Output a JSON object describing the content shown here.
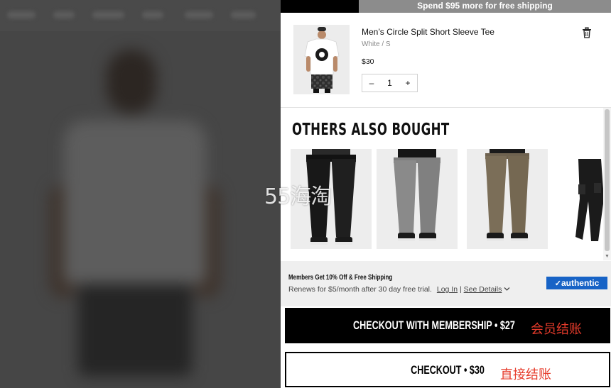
{
  "shipping_banner": {
    "text": "Spend $95 more for free shipping"
  },
  "cart_item": {
    "name": "Men’s Circle Split Short Sleeve Tee",
    "variant": "White / S",
    "price": "$30",
    "quantity": "1",
    "decrement_label": "–",
    "increment_label": "+"
  },
  "recommendations": {
    "title": "OTHERS ALSO BOUGHT",
    "items": [
      {
        "image": "black-pants-product-image"
      },
      {
        "image": "grey-pants-product-image"
      },
      {
        "image": "khaki-pants-product-image"
      },
      {
        "image": "black-cargo-pants-product-image"
      }
    ]
  },
  "watermark": {
    "text": "55海淘"
  },
  "membership": {
    "headline": "Members Get 10% Off & Free Shipping",
    "subtext": "Renews for $5/month after 30 day free trial.",
    "login_link": "Log In",
    "separator": "|",
    "details_link": "See Details",
    "brand": "authentic"
  },
  "buttons": {
    "membership_checkout": "CHECKOUT WITH MEMBERSHIP • $27",
    "membership_note": "会员结账",
    "checkout": "CHECKOUT • $30",
    "checkout_note": "直接结账"
  },
  "colors": {
    "accent_blue": "#1763c6",
    "note_red": "#e63b2b",
    "banner_grey": "#8c8c8c"
  }
}
